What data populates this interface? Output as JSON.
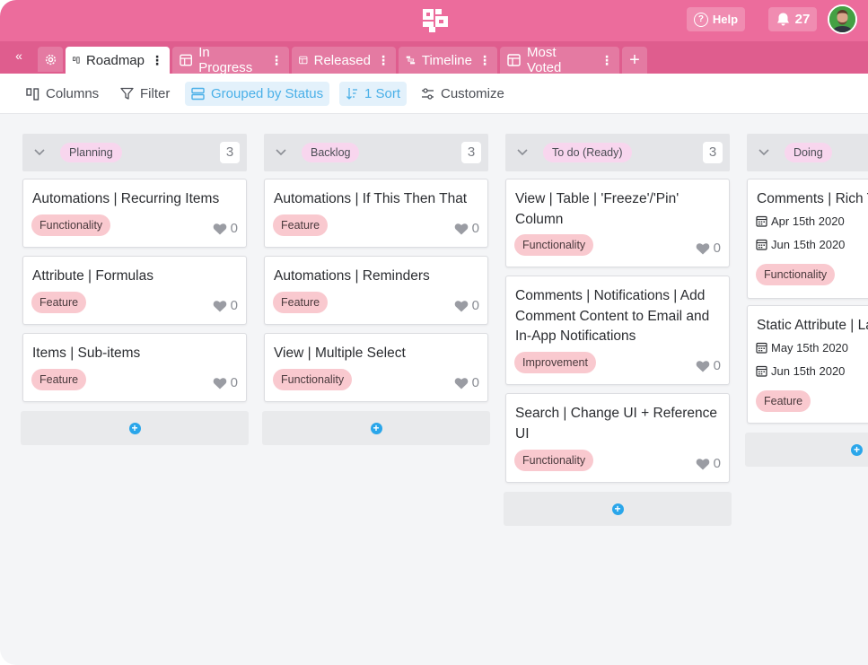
{
  "header": {
    "help_label": "Help",
    "notification_count": "27"
  },
  "tabs": {
    "collapse_glyph": "«",
    "items": [
      {
        "label": "Roadmap",
        "icon": "kanban-icon",
        "active": true
      },
      {
        "label": "In Progress",
        "icon": "table-icon",
        "active": false
      },
      {
        "label": "Released",
        "icon": "table-icon",
        "active": false
      },
      {
        "label": "Timeline",
        "icon": "timeline-icon",
        "active": false
      },
      {
        "label": "Most Voted",
        "icon": "table-icon",
        "active": false
      }
    ],
    "kebab": "⋮",
    "add_glyph": "+"
  },
  "toolbar": {
    "columns_label": "Columns",
    "filter_label": "Filter",
    "grouped_label": "Grouped by Status",
    "sort_label": "1 Sort",
    "customize_label": "Customize"
  },
  "board": {
    "columns": [
      {
        "name": "Planning",
        "count": "3",
        "cards": [
          {
            "title": "Automations | Recurring Items",
            "tag": "Functionality",
            "likes": "0"
          },
          {
            "title": "Attribute | Formulas",
            "tag": "Feature",
            "likes": "0"
          },
          {
            "title": "Items | Sub-items",
            "tag": "Feature",
            "likes": "0"
          }
        ]
      },
      {
        "name": "Backlog",
        "count": "3",
        "cards": [
          {
            "title": "Automations | If This Then That",
            "tag": "Feature",
            "likes": "0"
          },
          {
            "title": "Automations | Reminders",
            "tag": "Feature",
            "likes": "0"
          },
          {
            "title": "View | Multiple Select",
            "tag": "Functionality",
            "likes": "0"
          }
        ]
      },
      {
        "name": "To do (Ready)",
        "count": "3",
        "cards": [
          {
            "title": "View | Table | 'Freeze'/'Pin' Column",
            "tag": "Functionality",
            "likes": "0"
          },
          {
            "title": "Comments | Notifications | Add Comment Content to Email and In-App Notifications",
            "tag": "Improvement",
            "likes": "0"
          },
          {
            "title": "Search | Change UI + Reference UI",
            "tag": "Functionality",
            "likes": "0"
          }
        ]
      },
      {
        "name": "Doing",
        "count": "",
        "cards": [
          {
            "title": "Comments | Rich T",
            "date1": "Apr 15th 2020",
            "date2": "Jun 15th 2020",
            "tag": "Functionality"
          },
          {
            "title": "Static Attribute | La",
            "date1": "May 15th 2020",
            "date2": "Jun 15th 2020",
            "tag": "Feature"
          }
        ]
      }
    ]
  },
  "colors": {
    "topbar": "#ec6c9c",
    "tabsbar": "#df5d8e",
    "accent_blue": "#2aa6ea",
    "status_pill": "#f8d6ee",
    "tag": "#f9c9cf"
  }
}
